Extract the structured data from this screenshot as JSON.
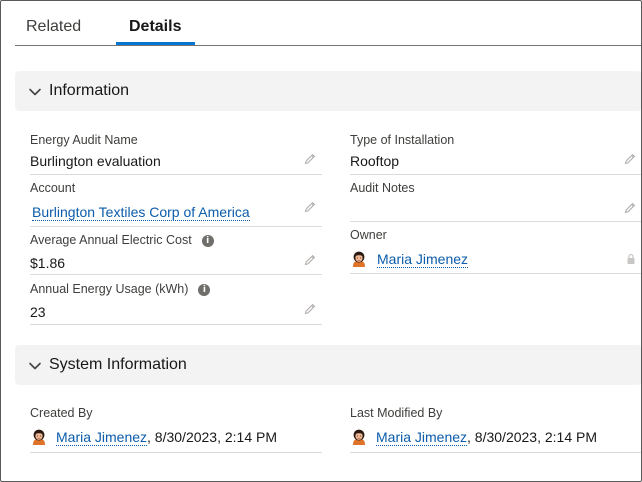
{
  "tabs": [
    {
      "label": "Related",
      "active": false
    },
    {
      "label": "Details",
      "active": true
    }
  ],
  "colors": {
    "accent": "#0176d3",
    "link": "#0b5cab",
    "section_bg": "#f3f3f3"
  },
  "information": {
    "title": "Information",
    "energy_audit_name": {
      "label": "Energy Audit Name",
      "value": "Burlington evaluation"
    },
    "type_of_installation": {
      "label": "Type of Installation",
      "value": "Rooftop"
    },
    "account": {
      "label": "Account",
      "value": "Burlington Textiles Corp of America"
    },
    "audit_notes": {
      "label": "Audit Notes",
      "value": ""
    },
    "average_annual_electric_cost": {
      "label": "Average Annual Electric Cost",
      "value": "$1.86"
    },
    "owner": {
      "label": "Owner",
      "value": "Maria Jimenez"
    },
    "annual_energy_usage": {
      "label": "Annual Energy Usage (kWh)",
      "value": "23"
    }
  },
  "system_information": {
    "title": "System Information",
    "created_by": {
      "label": "Created By",
      "user": "Maria Jimenez",
      "date": ", 8/30/2023, 2:14 PM"
    },
    "last_modified_by": {
      "label": "Last Modified By",
      "user": "Maria Jimenez",
      "date": ", 8/30/2023, 2:14 PM"
    }
  },
  "icons": {
    "edit": "pencil-icon",
    "help": "info-icon",
    "collapse": "chevron-down-icon",
    "read_only": "lock-icon",
    "user": "avatar"
  }
}
